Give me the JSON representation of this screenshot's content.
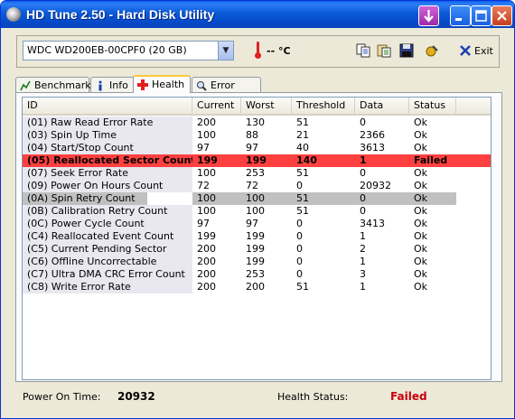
{
  "window": {
    "title": "HD Tune 2.50 - Hard Disk Utility"
  },
  "toolbar": {
    "drive": "WDC WD200EB-00CPF0 (20 GB)",
    "temperature": "-- °C",
    "exit_label": "Exit"
  },
  "tabs": [
    {
      "label": "Benchmark",
      "icon": "benchmark-icon"
    },
    {
      "label": "Info",
      "icon": "info-icon"
    },
    {
      "label": "Health",
      "icon": "health-cross-icon",
      "active": true
    },
    {
      "label": "Error Scan",
      "icon": "magnifier-icon"
    }
  ],
  "table": {
    "columns": [
      "ID",
      "Current",
      "Worst",
      "Threshold",
      "Data",
      "Status"
    ],
    "rows": [
      {
        "id": "(01) Raw Read Error Rate",
        "current": "200",
        "worst": "130",
        "threshold": "51",
        "data": "0",
        "status": "Ok"
      },
      {
        "id": "(03) Spin Up Time",
        "current": "100",
        "worst": "88",
        "threshold": "21",
        "data": "2366",
        "status": "Ok"
      },
      {
        "id": "(04) Start/Stop Count",
        "current": "97",
        "worst": "97",
        "threshold": "40",
        "data": "3613",
        "status": "Ok"
      },
      {
        "id": "(05) Reallocated Sector Count",
        "current": "199",
        "worst": "199",
        "threshold": "140",
        "data": "1",
        "status": "Failed",
        "state": "failed"
      },
      {
        "id": "(07) Seek Error Rate",
        "current": "100",
        "worst": "253",
        "threshold": "51",
        "data": "0",
        "status": "Ok"
      },
      {
        "id": "(09) Power On Hours Count",
        "current": "72",
        "worst": "72",
        "threshold": "0",
        "data": "20932",
        "status": "Ok"
      },
      {
        "id": "(0A) Spin Retry Count",
        "current": "100",
        "worst": "100",
        "threshold": "51",
        "data": "0",
        "status": "Ok",
        "state": "selected"
      },
      {
        "id": "(0B) Calibration Retry Count",
        "current": "100",
        "worst": "100",
        "threshold": "51",
        "data": "0",
        "status": "Ok"
      },
      {
        "id": "(0C) Power Cycle Count",
        "current": "97",
        "worst": "97",
        "threshold": "0",
        "data": "3413",
        "status": "Ok"
      },
      {
        "id": "(C4) Reallocated Event Count",
        "current": "199",
        "worst": "199",
        "threshold": "0",
        "data": "1",
        "status": "Ok"
      },
      {
        "id": "(C5) Current Pending Sector",
        "current": "200",
        "worst": "199",
        "threshold": "0",
        "data": "2",
        "status": "Ok"
      },
      {
        "id": "(C6) Offline Uncorrectable",
        "current": "200",
        "worst": "199",
        "threshold": "0",
        "data": "1",
        "status": "Ok"
      },
      {
        "id": "(C7) Ultra DMA CRC Error Count",
        "current": "200",
        "worst": "253",
        "threshold": "0",
        "data": "3",
        "status": "Ok"
      },
      {
        "id": "(C8) Write Error Rate",
        "current": "200",
        "worst": "200",
        "threshold": "51",
        "data": "1",
        "status": "Ok"
      }
    ]
  },
  "statusbar": {
    "power_on_label": "Power On Time:",
    "power_on_value": "20932",
    "health_label": "Health Status:",
    "health_value": "Failed"
  },
  "colors": {
    "failed_row": "#fe4040",
    "failed_text": "#c8000f",
    "selected_row": "#c0c0c0",
    "titlebar": "#0a5fe8"
  }
}
